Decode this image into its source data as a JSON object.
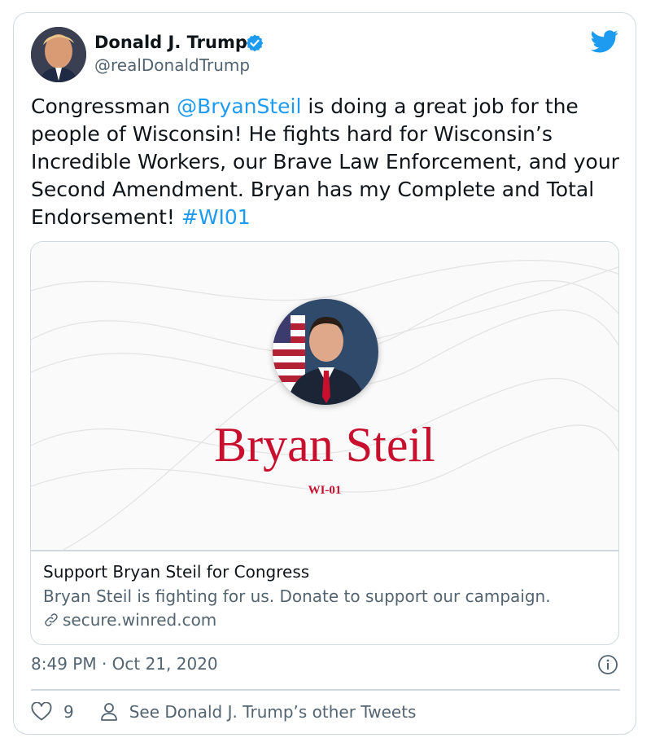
{
  "author": {
    "name": "Donald J. Trump",
    "handle": "@realDonaldTrump",
    "verified": true
  },
  "tweet": {
    "text_before": "Congressman ",
    "mention": "@BryanSteil",
    "text_after": " is doing a great job for the people of Wisconsin! He fights hard for Wisconsin’s Incredible Workers, our Brave Law Enforcement, and your Second Amendment. Bryan has my Complete and Total Endorsement! ",
    "hashtag": "#WI01"
  },
  "link_card": {
    "preview_name": "Bryan Steil",
    "preview_district": "WI-01",
    "title": "Support Bryan Steil for Congress",
    "description": "Bryan Steil is fighting for us. Donate to support our campaign.",
    "domain": "secure.winred.com"
  },
  "meta": {
    "timestamp": "8:49 PM · Oct 21, 2020"
  },
  "actions": {
    "like_count": "9",
    "see_other": "See Donald J. Trump’s other Tweets"
  },
  "colors": {
    "link": "#1d9bf0",
    "secondary_text": "#536471",
    "border": "#cfd9de",
    "preview_red": "#c8102e"
  },
  "icons": [
    "verified-badge-icon",
    "twitter-bird-icon",
    "link-icon",
    "info-icon",
    "heart-icon",
    "person-icon"
  ]
}
